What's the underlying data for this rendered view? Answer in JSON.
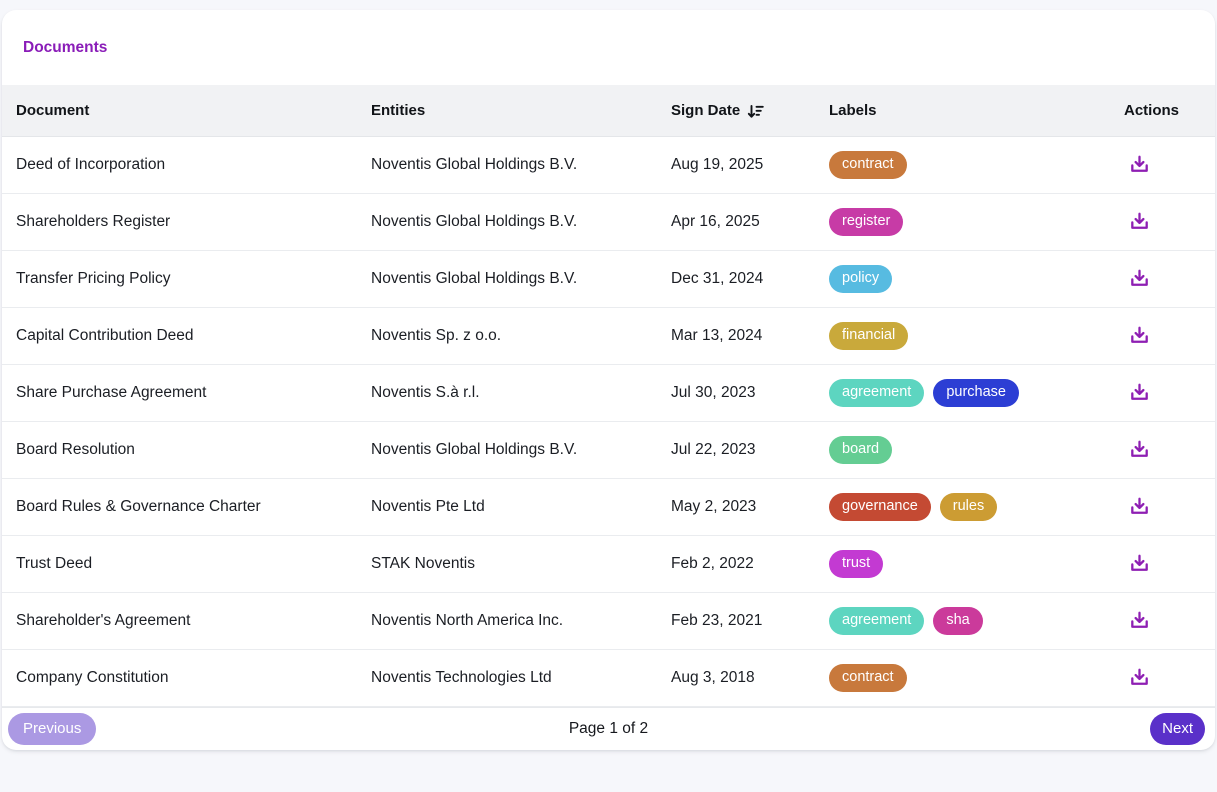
{
  "page": {
    "title": "Documents",
    "accent_color": "#8a1cb8",
    "background_color": "#f6f7fb"
  },
  "table": {
    "columns": [
      "Document",
      "Entities",
      "Sign Date",
      "Labels",
      "Actions"
    ],
    "sort": {
      "column": "Sign Date",
      "direction": "descending",
      "icon": "sort-descending-icon"
    },
    "rows": [
      {
        "document": "Deed of Incorporation",
        "entity": "Noventis Global Holdings B.V.",
        "sign_date": "Aug 19, 2025",
        "labels": [
          {
            "text": "contract",
            "color": "#c8793c"
          }
        ]
      },
      {
        "document": "Shareholders Register",
        "entity": "Noventis Global Holdings B.V.",
        "sign_date": "Apr 16, 2025",
        "labels": [
          {
            "text": "register",
            "color": "#c73ba6"
          }
        ]
      },
      {
        "document": "Transfer Pricing Policy",
        "entity": "Noventis Global Holdings B.V.",
        "sign_date": "Dec 31, 2024",
        "labels": [
          {
            "text": "policy",
            "color": "#57bbe1"
          }
        ]
      },
      {
        "document": "Capital Contribution Deed",
        "entity": "Noventis Sp. z o.o.",
        "sign_date": "Mar 13, 2024",
        "labels": [
          {
            "text": "financial",
            "color": "#c9a93b"
          }
        ]
      },
      {
        "document": "Share Purchase Agreement",
        "entity": "Noventis S.à r.l.",
        "sign_date": "Jul 30, 2023",
        "labels": [
          {
            "text": "agreement",
            "color": "#5dd5c0"
          },
          {
            "text": "purchase",
            "color": "#2c3ed4"
          }
        ]
      },
      {
        "document": "Board Resolution",
        "entity": "Noventis Global Holdings B.V.",
        "sign_date": "Jul 22, 2023",
        "labels": [
          {
            "text": "board",
            "color": "#64cd93"
          }
        ]
      },
      {
        "document": "Board Rules & Governance Charter",
        "entity": "Noventis Pte Ltd",
        "sign_date": "May 2, 2023",
        "labels": [
          {
            "text": "governance",
            "color": "#c44a33"
          },
          {
            "text": "rules",
            "color": "#cc9c33"
          }
        ]
      },
      {
        "document": "Trust Deed",
        "entity": "STAK Noventis",
        "sign_date": "Feb 2, 2022",
        "labels": [
          {
            "text": "trust",
            "color": "#c33ad2"
          }
        ]
      },
      {
        "document": "Shareholder's Agreement",
        "entity": "Noventis North America Inc.",
        "sign_date": "Feb 23, 2021",
        "labels": [
          {
            "text": "agreement",
            "color": "#5dd5c0"
          },
          {
            "text": "sha",
            "color": "#cb3a9b"
          }
        ]
      },
      {
        "document": "Company Constitution",
        "entity": "Noventis Technologies Ltd",
        "sign_date": "Aug 3, 2018",
        "labels": [
          {
            "text": "contract",
            "color": "#c8793c"
          }
        ]
      }
    ],
    "actions": {
      "download_icon": "download-icon",
      "download_icon_color": "#8e1fb3"
    }
  },
  "pagination": {
    "previous_label": "Previous",
    "page_status": "Page 1 of 2",
    "next_label": "Next",
    "previous_button_color": "#ab99e3",
    "next_button_color": "#5a30c9"
  }
}
